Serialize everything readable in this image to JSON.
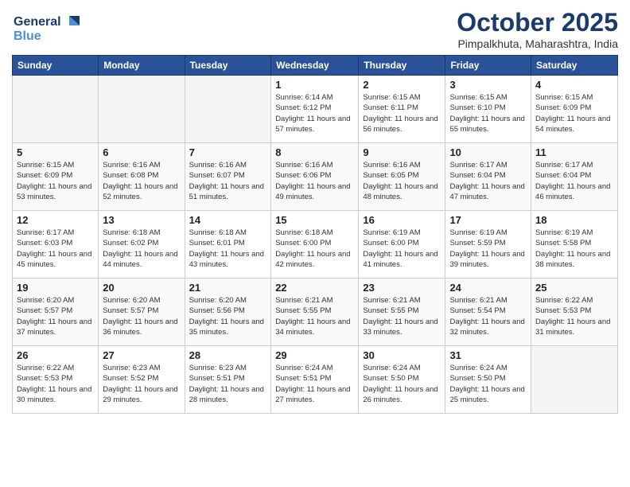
{
  "logo": {
    "line1": "General",
    "line2": "Blue"
  },
  "title": "October 2025",
  "location": "Pimpalkhuta, Maharashtra, India",
  "weekdays": [
    "Sunday",
    "Monday",
    "Tuesday",
    "Wednesday",
    "Thursday",
    "Friday",
    "Saturday"
  ],
  "weeks": [
    [
      {
        "day": "",
        "sunrise": "",
        "sunset": "",
        "daylight": ""
      },
      {
        "day": "",
        "sunrise": "",
        "sunset": "",
        "daylight": ""
      },
      {
        "day": "",
        "sunrise": "",
        "sunset": "",
        "daylight": ""
      },
      {
        "day": "1",
        "sunrise": "Sunrise: 6:14 AM",
        "sunset": "Sunset: 6:12 PM",
        "daylight": "Daylight: 11 hours and 57 minutes."
      },
      {
        "day": "2",
        "sunrise": "Sunrise: 6:15 AM",
        "sunset": "Sunset: 6:11 PM",
        "daylight": "Daylight: 11 hours and 56 minutes."
      },
      {
        "day": "3",
        "sunrise": "Sunrise: 6:15 AM",
        "sunset": "Sunset: 6:10 PM",
        "daylight": "Daylight: 11 hours and 55 minutes."
      },
      {
        "day": "4",
        "sunrise": "Sunrise: 6:15 AM",
        "sunset": "Sunset: 6:09 PM",
        "daylight": "Daylight: 11 hours and 54 minutes."
      }
    ],
    [
      {
        "day": "5",
        "sunrise": "Sunrise: 6:15 AM",
        "sunset": "Sunset: 6:09 PM",
        "daylight": "Daylight: 11 hours and 53 minutes."
      },
      {
        "day": "6",
        "sunrise": "Sunrise: 6:16 AM",
        "sunset": "Sunset: 6:08 PM",
        "daylight": "Daylight: 11 hours and 52 minutes."
      },
      {
        "day": "7",
        "sunrise": "Sunrise: 6:16 AM",
        "sunset": "Sunset: 6:07 PM",
        "daylight": "Daylight: 11 hours and 51 minutes."
      },
      {
        "day": "8",
        "sunrise": "Sunrise: 6:16 AM",
        "sunset": "Sunset: 6:06 PM",
        "daylight": "Daylight: 11 hours and 49 minutes."
      },
      {
        "day": "9",
        "sunrise": "Sunrise: 6:16 AM",
        "sunset": "Sunset: 6:05 PM",
        "daylight": "Daylight: 11 hours and 48 minutes."
      },
      {
        "day": "10",
        "sunrise": "Sunrise: 6:17 AM",
        "sunset": "Sunset: 6:04 PM",
        "daylight": "Daylight: 11 hours and 47 minutes."
      },
      {
        "day": "11",
        "sunrise": "Sunrise: 6:17 AM",
        "sunset": "Sunset: 6:04 PM",
        "daylight": "Daylight: 11 hours and 46 minutes."
      }
    ],
    [
      {
        "day": "12",
        "sunrise": "Sunrise: 6:17 AM",
        "sunset": "Sunset: 6:03 PM",
        "daylight": "Daylight: 11 hours and 45 minutes."
      },
      {
        "day": "13",
        "sunrise": "Sunrise: 6:18 AM",
        "sunset": "Sunset: 6:02 PM",
        "daylight": "Daylight: 11 hours and 44 minutes."
      },
      {
        "day": "14",
        "sunrise": "Sunrise: 6:18 AM",
        "sunset": "Sunset: 6:01 PM",
        "daylight": "Daylight: 11 hours and 43 minutes."
      },
      {
        "day": "15",
        "sunrise": "Sunrise: 6:18 AM",
        "sunset": "Sunset: 6:00 PM",
        "daylight": "Daylight: 11 hours and 42 minutes."
      },
      {
        "day": "16",
        "sunrise": "Sunrise: 6:19 AM",
        "sunset": "Sunset: 6:00 PM",
        "daylight": "Daylight: 11 hours and 41 minutes."
      },
      {
        "day": "17",
        "sunrise": "Sunrise: 6:19 AM",
        "sunset": "Sunset: 5:59 PM",
        "daylight": "Daylight: 11 hours and 39 minutes."
      },
      {
        "day": "18",
        "sunrise": "Sunrise: 6:19 AM",
        "sunset": "Sunset: 5:58 PM",
        "daylight": "Daylight: 11 hours and 38 minutes."
      }
    ],
    [
      {
        "day": "19",
        "sunrise": "Sunrise: 6:20 AM",
        "sunset": "Sunset: 5:57 PM",
        "daylight": "Daylight: 11 hours and 37 minutes."
      },
      {
        "day": "20",
        "sunrise": "Sunrise: 6:20 AM",
        "sunset": "Sunset: 5:57 PM",
        "daylight": "Daylight: 11 hours and 36 minutes."
      },
      {
        "day": "21",
        "sunrise": "Sunrise: 6:20 AM",
        "sunset": "Sunset: 5:56 PM",
        "daylight": "Daylight: 11 hours and 35 minutes."
      },
      {
        "day": "22",
        "sunrise": "Sunrise: 6:21 AM",
        "sunset": "Sunset: 5:55 PM",
        "daylight": "Daylight: 11 hours and 34 minutes."
      },
      {
        "day": "23",
        "sunrise": "Sunrise: 6:21 AM",
        "sunset": "Sunset: 5:55 PM",
        "daylight": "Daylight: 11 hours and 33 minutes."
      },
      {
        "day": "24",
        "sunrise": "Sunrise: 6:21 AM",
        "sunset": "Sunset: 5:54 PM",
        "daylight": "Daylight: 11 hours and 32 minutes."
      },
      {
        "day": "25",
        "sunrise": "Sunrise: 6:22 AM",
        "sunset": "Sunset: 5:53 PM",
        "daylight": "Daylight: 11 hours and 31 minutes."
      }
    ],
    [
      {
        "day": "26",
        "sunrise": "Sunrise: 6:22 AM",
        "sunset": "Sunset: 5:53 PM",
        "daylight": "Daylight: 11 hours and 30 minutes."
      },
      {
        "day": "27",
        "sunrise": "Sunrise: 6:23 AM",
        "sunset": "Sunset: 5:52 PM",
        "daylight": "Daylight: 11 hours and 29 minutes."
      },
      {
        "day": "28",
        "sunrise": "Sunrise: 6:23 AM",
        "sunset": "Sunset: 5:51 PM",
        "daylight": "Daylight: 11 hours and 28 minutes."
      },
      {
        "day": "29",
        "sunrise": "Sunrise: 6:24 AM",
        "sunset": "Sunset: 5:51 PM",
        "daylight": "Daylight: 11 hours and 27 minutes."
      },
      {
        "day": "30",
        "sunrise": "Sunrise: 6:24 AM",
        "sunset": "Sunset: 5:50 PM",
        "daylight": "Daylight: 11 hours and 26 minutes."
      },
      {
        "day": "31",
        "sunrise": "Sunrise: 6:24 AM",
        "sunset": "Sunset: 5:50 PM",
        "daylight": "Daylight: 11 hours and 25 minutes."
      },
      {
        "day": "",
        "sunrise": "",
        "sunset": "",
        "daylight": ""
      }
    ]
  ]
}
